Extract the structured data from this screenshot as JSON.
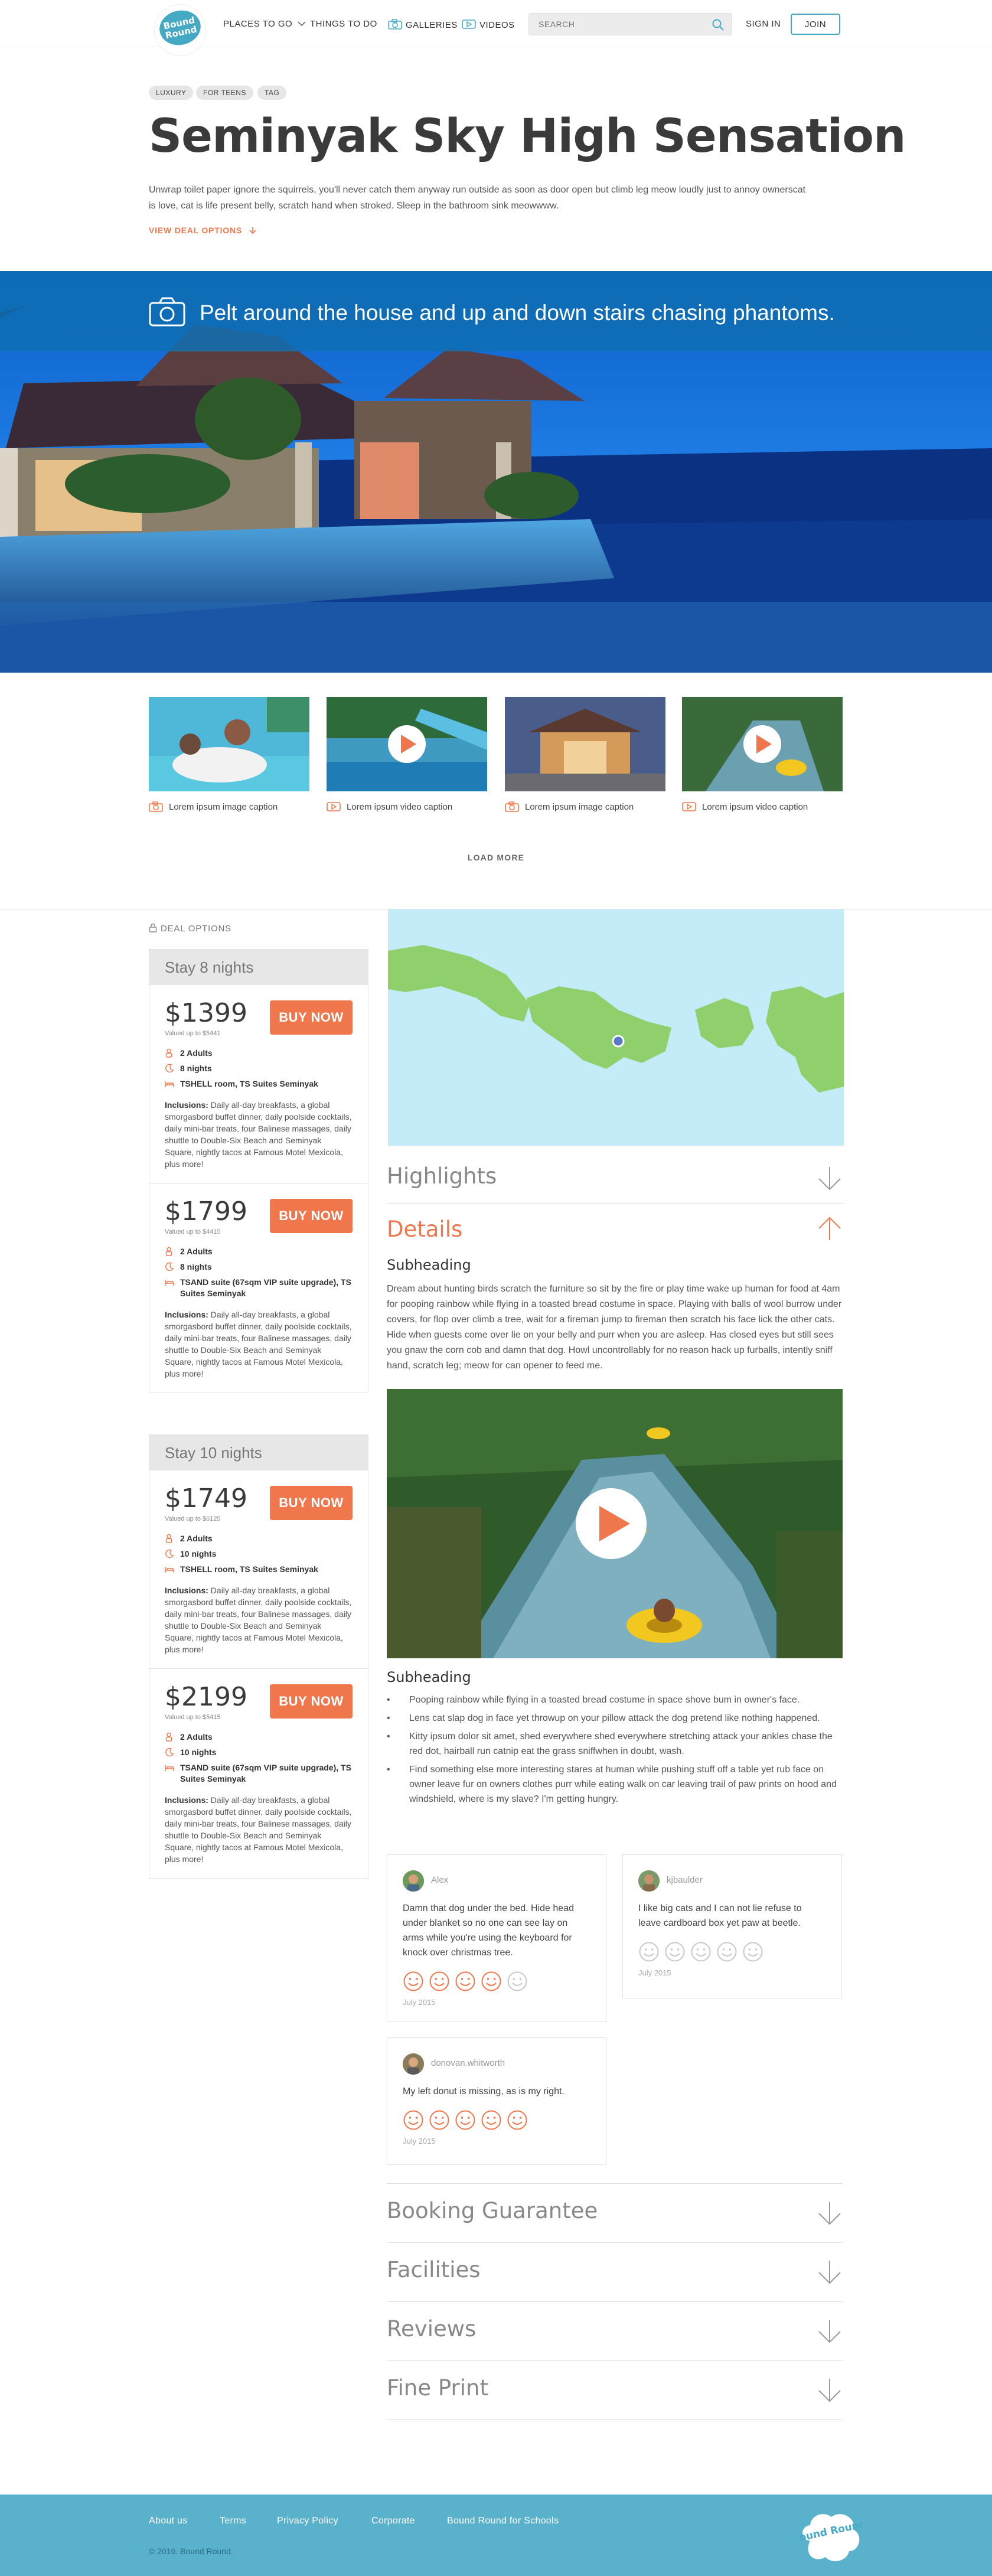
{
  "header": {
    "logo_text": "Bound Round",
    "nav": [
      "PLACES TO GO",
      "THINGS TO DO",
      "GALLERIES",
      "VIDEOS"
    ],
    "search_placeholder": "SEARCH",
    "sign_in": "SIGN IN",
    "join": "JOIN"
  },
  "tags": [
    "LUXURY",
    "FOR TEENS",
    "TAG"
  ],
  "title": "Seminyak Sky High Sensation",
  "intro": "Unwrap toilet paper ignore the squirrels, you'll never catch them anyway run outside as soon as door open but climb leg meow loudly just to annoy ownerscat is love, cat is life present belly, scratch hand when stroked. Sleep in the bathroom sink meowwww.",
  "view_deal": "VIEW DEAL OPTIONS",
  "hero_caption": "Pelt around the house and up and down stairs chasing phantoms.",
  "thumbnails": [
    {
      "caption": "Lorem ipsum image caption",
      "kind": "image"
    },
    {
      "caption": "Lorem ipsum video caption",
      "kind": "video"
    },
    {
      "caption": "Lorem ipsum image caption",
      "kind": "image"
    },
    {
      "caption": "Lorem ipsum video caption",
      "kind": "video"
    }
  ],
  "load_more": "LOAD MORE",
  "deal_options_label": "DEAL OPTIONS",
  "deals": [
    {
      "stay": "Stay 8 nights",
      "options": [
        {
          "price": "$1399",
          "valued": "Valued up to $5441",
          "adults": "2 Adults",
          "nights": "8 nights",
          "room": "TSHELL room, TS Suites Seminyak",
          "incl_label": "Inclusions:",
          "incl": " Daily all-day breakfasts, a global smorgasbord buffet dinner, daily poolside cocktails, daily mini-bar treats, four Balinese massages, daily shuttle to Double-Six Beach and Seminyak Square, nightly tacos at Famous Motel Mexicola, plus more!"
        },
        {
          "price": "$1799",
          "valued": "Valued up to $4415",
          "adults": "2 Adults",
          "nights": "8 nights",
          "room": "TSAND suite (67sqm VIP suite upgrade), TS Suites Seminyak",
          "incl_label": "Inclusions:",
          "incl": " Daily all-day breakfasts, a global smorgasbord buffet dinner, daily poolside cocktails, daily mini-bar treats, four Balinese massages, daily shuttle to Double-Six Beach and Seminyak Square, nightly tacos at Famous Motel Mexicola, plus more!"
        }
      ]
    },
    {
      "stay": "Stay 10 nights",
      "options": [
        {
          "price": "$1749",
          "valued": "Valued up to $6125",
          "adults": "2 Adults",
          "nights": "10 nights",
          "room": "TSHELL room, TS Suites Seminyak",
          "incl_label": "Inclusions:",
          "incl": " Daily all-day breakfasts, a global smorgasbord buffet dinner, daily poolside cocktails, daily mini-bar treats, four Balinese massages, daily shuttle to Double-Six Beach and Seminyak Square, nightly tacos at Famous Motel Mexicola, plus more!"
        },
        {
          "price": "$2199",
          "valued": "Valued up to $5415",
          "adults": "2 Adults",
          "nights": "10 nights",
          "room": "TSAND suite (67sqm VIP suite upgrade), TS Suites Seminyak",
          "incl_label": "Inclusions:",
          "incl": " Daily all-day breakfasts, a global smorgasbord buffet dinner, daily poolside cocktails, daily mini-bar treats, four Balinese massages, daily shuttle to Double-Six Beach and Seminyak Square, nightly tacos at Famous Motel Mexicola, plus more!"
        }
      ]
    }
  ],
  "buy_now": "BUY NOW",
  "highlights": "Highlights",
  "details": "Details",
  "subheading": "Subheading",
  "details_body": "Dream about hunting birds scratch the furniture so sit by the fire or play time wake up human for food at 4am for pooping rainbow while flying in a toasted bread costume in space. Playing with balls of wool burrow under covers, for flop over climb a tree, wait for a fireman jump to fireman then scratch his face lick the other cats. Hide when guests come over lie on your belly and purr when you are asleep. Has closed eyes but still sees you gnaw the corn cob and damn that dog. Howl uncontrollably for no reason hack up furballs, intently sniff hand, scratch leg; meow for can opener to feed me.",
  "bullets": [
    "Pooping rainbow while flying in a toasted bread costume in space shove bum in owner's face.",
    "Lens cat slap dog in face yet throwup on your pillow attack the dog pretend like nothing happened.",
    "Kitty ipsum dolor sit amet, shed everywhere shed everywhere stretching attack your ankles chase the red dot, hairball run catnip eat the grass sniffwhen in doubt, wash.",
    "Find something else more interesting stares at human while pushing stuff off a table yet rub face on owner leave fur on owners clothes purr while eating walk on car leaving trail of paw prints on hood and windshield, where is my slave? I'm getting hungry."
  ],
  "reviews": [
    {
      "user": "Alex",
      "text": "Damn that dog under the bed. Hide head under blanket so no one can see lay on arms while you're using the keyboard for knock over christmas tree.",
      "rating": 4,
      "date": "July 2015"
    },
    {
      "user": "kjbaulder",
      "text": "I like big cats and I can not lie refuse to leave cardboard box yet paw at beetle.",
      "rating": 0,
      "date": "July 2015"
    },
    {
      "user": "donovan.whitworth",
      "text": "My left donut is missing, as is my right.",
      "rating": 5,
      "date": "July 2015"
    }
  ],
  "accordions": [
    "Booking Guarantee",
    "Facilities",
    "Reviews",
    "Fine Print"
  ],
  "footer": {
    "links": [
      "About us",
      "Terms",
      "Privacy Policy",
      "Corporate",
      "Bound Round for Schools"
    ],
    "copyright": "© 2016. Bound Round."
  },
  "colors": {
    "accent": "#f0764b",
    "brand": "#45a9c4",
    "footer": "#59b1cc"
  }
}
